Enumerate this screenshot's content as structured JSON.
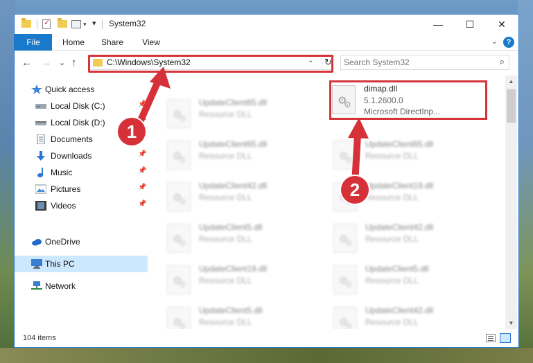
{
  "window": {
    "title": "System32",
    "controls": {
      "minimize": "—",
      "maximize": "☐",
      "close": "✕"
    }
  },
  "ribbon": {
    "tabs": [
      "File",
      "Home",
      "Share",
      "View"
    ],
    "expand": "⌄",
    "help": "?"
  },
  "nav": {
    "back": "←",
    "forward": "→",
    "recent": "⌄",
    "up": "↑",
    "address": "C:\\Windows\\System32",
    "address_dropdown": "⌄",
    "refresh": "↻",
    "search_placeholder": "Search System32",
    "search_icon": "⌕"
  },
  "sidebar": {
    "items": [
      {
        "label": "Quick access",
        "icon": "star-icon",
        "pinned": false
      },
      {
        "label": "Local Disk (C:)",
        "icon": "drive-icon",
        "pinned": true
      },
      {
        "label": "Local Disk (D:)",
        "icon": "drive-icon",
        "pinned": true
      },
      {
        "label": "Documents",
        "icon": "document-icon",
        "pinned": true
      },
      {
        "label": "Downloads",
        "icon": "download-icon",
        "pinned": true
      },
      {
        "label": "Music",
        "icon": "music-icon",
        "pinned": true
      },
      {
        "label": "Pictures",
        "icon": "pictures-icon",
        "pinned": true
      },
      {
        "label": "Videos",
        "icon": "video-icon",
        "pinned": true
      },
      {
        "label": "OneDrive",
        "icon": "cloud-icon",
        "pinned": false
      },
      {
        "label": "This PC",
        "icon": "computer-icon",
        "pinned": false,
        "selected": true
      },
      {
        "label": "Network",
        "icon": "network-icon",
        "pinned": false
      }
    ],
    "pin_glyph": "📌"
  },
  "files": {
    "highlighted": {
      "name": "dimap.dll",
      "version": "5.1.2600.0",
      "description": "Microsoft DirectInp..."
    },
    "left_column": [
      {
        "name": "UpdateClient65.dll",
        "type": "Resource DLL"
      },
      {
        "name": "UpdateClient65.dll",
        "type": "Resource DLL"
      },
      {
        "name": "UpdateClient42.dll",
        "type": "Resource DLL"
      },
      {
        "name": "UpdateClient5.dll",
        "type": "Resource DLL"
      },
      {
        "name": "UpdateClient19.dll",
        "type": "Resource DLL"
      },
      {
        "name": "UpdateClient5.dll",
        "type": "Resource DLL"
      }
    ],
    "right_column": [
      {
        "name": "UpdateClient65.dll",
        "type": "Resource DLL"
      },
      {
        "name": "UpdateClient19.dll",
        "type": "Resource DLL"
      },
      {
        "name": "UpdateClient42.dll",
        "type": "Resource DLL"
      },
      {
        "name": "UpdateClient5.dll",
        "type": "Resource DLL"
      },
      {
        "name": "UpdateClient42.dll",
        "type": "Resource DLL"
      }
    ]
  },
  "status": {
    "count": "104 items"
  },
  "annotations": {
    "badge1": "1",
    "badge2": "2",
    "accent": "#d6333b"
  },
  "colors": {
    "accent_blue": "#1979ca",
    "selection": "#cce8ff"
  }
}
